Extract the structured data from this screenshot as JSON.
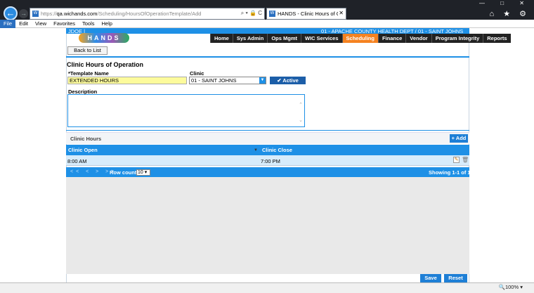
{
  "browser": {
    "url_prefix": "https://",
    "url_domain": "qa.wichands.com",
    "url_path": "/Scheduling/HoursOfOperationTemplate/Add",
    "addr_tools": "⌕ ▾ 🔒 C",
    "tab_title": "HANDS - Clinic Hours of O...",
    "tab_close": "✕",
    "window_controls": "— □ ✕",
    "toolbar_icons": "⌂ ★ ⚙",
    "favicon": "W",
    "menu": [
      "File",
      "Edit",
      "View",
      "Favorites",
      "Tools",
      "Help"
    ],
    "zoom": "🔍100% ▾"
  },
  "header": {
    "user": "JDOE |",
    "clinic_info": "01 - APACHE COUNTY HEALTH DEPT / 01 - SAINT JOHNS",
    "logo_text": "HANDS",
    "nav": [
      "Home",
      "Sys Admin",
      "Ops Mgmt",
      "WIC Services",
      "Scheduling",
      "Finance",
      "Vendor",
      "Program Integrity",
      "Reports"
    ],
    "active_nav": "Scheduling"
  },
  "back_label": "Back to List",
  "form": {
    "title": "Clinic Hours of Operation",
    "template_name_label": "*Template Name",
    "template_name_value": "EXTENDED HOURS",
    "clinic_label": "Clinic",
    "clinic_value": "01 - SAINT JOHNS",
    "active_label": "✔ Active",
    "description_label": "Description",
    "description_value": ""
  },
  "grid": {
    "title": "Clinic Hours",
    "add_label": "+ Add",
    "columns": [
      "Clinic Open",
      "Clinic Close"
    ],
    "rows": [
      {
        "open": "8:00 AM",
        "close": "7:00 PM"
      }
    ],
    "pager_nav": "<< < > >>",
    "row_count_label": "Row count:",
    "row_count_value": "10",
    "showing": "Showing 1-1 of 1"
  },
  "footer": {
    "save": "Save",
    "reset": "Reset"
  },
  "colors": {
    "accent": "#1e90e6",
    "active_nav": "#f58220",
    "template_input": "#fdfb9c"
  }
}
